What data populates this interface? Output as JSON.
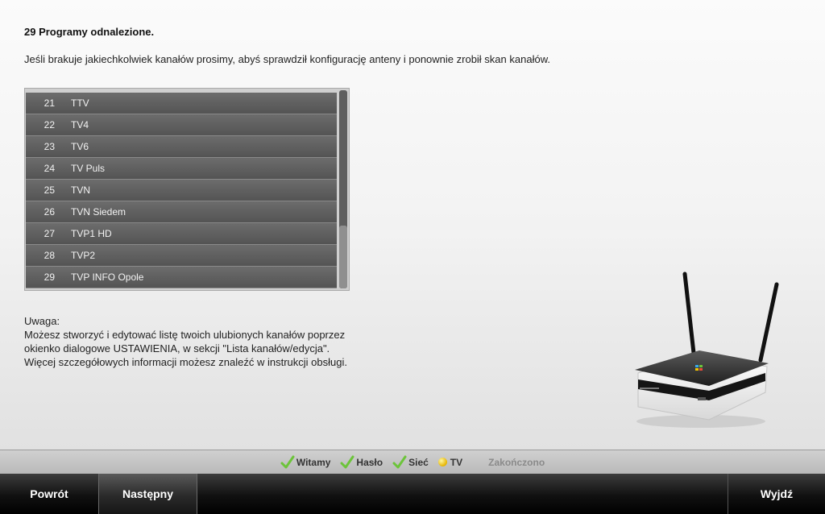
{
  "header": {
    "title": "29 Programy odnalezione.",
    "message": "Jeśli brakuje jakiechkolwiek kanałów prosimy, abyś sprawdził konfigurację anteny i ponownie zrobił skan kanałów."
  },
  "channels": [
    {
      "number": "21",
      "name": "TTV"
    },
    {
      "number": "22",
      "name": "TV4"
    },
    {
      "number": "23",
      "name": "TV6"
    },
    {
      "number": "24",
      "name": "TV Puls"
    },
    {
      "number": "25",
      "name": "TVN"
    },
    {
      "number": "26",
      "name": "TVN Siedem"
    },
    {
      "number": "27",
      "name": "TVP1 HD"
    },
    {
      "number": "28",
      "name": "TVP2"
    },
    {
      "number": "29",
      "name": "TVP INFO Opole"
    }
  ],
  "scroll_position": 0.7,
  "note": {
    "label": "Uwaga:",
    "line1": "Możesz stworzyć i edytować listę twoich ulubionych kanałów poprzez",
    "line2": "okienko dialogowe USTAWIENIA, w sekcji \"Lista kanałów/edycja\".",
    "line3": "Więcej szczegółowych informacji możesz znaleźć w instrukcji obsługi."
  },
  "steps": [
    {
      "label": "Witamy",
      "state": "done",
      "icon": "check-icon"
    },
    {
      "label": "Hasło",
      "state": "done",
      "icon": "check-icon"
    },
    {
      "label": "Sieć",
      "state": "done",
      "icon": "check-icon"
    },
    {
      "label": "TV",
      "state": "current",
      "icon": "dot-icon"
    },
    {
      "label": "Zakończono",
      "state": "pending"
    }
  ],
  "nav": {
    "back": "Powrót",
    "next": "Następny",
    "exit": "Wyjdź"
  },
  "colors": {
    "check": "#6cc43a",
    "current": "#f2c500",
    "pending_text": "#8a8a8a",
    "row_bg": "#5f5f5f"
  }
}
